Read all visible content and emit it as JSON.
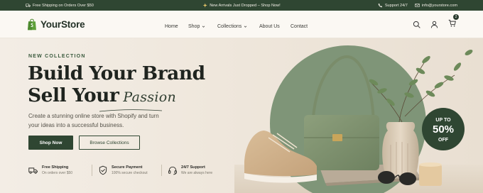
{
  "topbar": {
    "left": "Free Shipping on Orders Over $50",
    "center": "New Arrivals Just Dropped – Shop Now!",
    "support": "Support 24/7",
    "email": "info@yourstore.com"
  },
  "header": {
    "logo": "YourStore",
    "nav": {
      "home": "Home",
      "shop": "Shop",
      "collections": "Collections",
      "about": "About Us",
      "contact": "Contact"
    },
    "cart_count": "2"
  },
  "hero": {
    "eyebrow": "NEW COLLECTION",
    "headline_line1": "Build Your Brand",
    "headline_line2": "Sell Your",
    "headline_script": "Passion",
    "description": "Create a stunning online store with Shopify and turn your ideas into a successful business.",
    "primary_button": "Shop Now",
    "secondary_button": "Browse Collections",
    "badge": {
      "top": "UP TO",
      "value": "50%",
      "bottom": "OFF"
    }
  },
  "features": [
    {
      "title": "Free Shipping",
      "subtitle": "On orders over $50",
      "icon": "truck-icon"
    },
    {
      "title": "Secure Payment",
      "subtitle": "100% secure checkout",
      "icon": "shield-check-icon"
    },
    {
      "title": "24/7 Support",
      "subtitle": "We are always here",
      "icon": "headset-icon"
    }
  ],
  "colors": {
    "brand_dark_green": "#2f4632",
    "cream": "#f4efe8",
    "sage": "#7f9578"
  }
}
